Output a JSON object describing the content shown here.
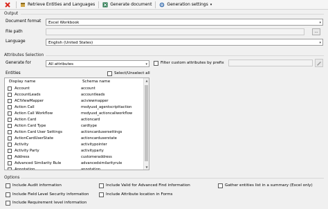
{
  "toolbar": {
    "retrieve_label": "Retrieve Entities and Languages",
    "generate_label": "Generate document",
    "settings_label": "Generation settings"
  },
  "output": {
    "group_label": "Output",
    "format_label": "Document format",
    "format_value": "Excel Workbook",
    "filepath_label": "File path",
    "filepath_value": "",
    "browse_label": "...",
    "language_label": "Language",
    "language_value": "English (United States)"
  },
  "attributes": {
    "group_label": "Attributes Selection",
    "generate_for_label": "Generate for",
    "generate_for_value": "All attributes",
    "filter_label": "Filter custom attributes by prefix",
    "filter_value": ""
  },
  "entities": {
    "label": "Entities",
    "select_all_label": "Select/Unselect all",
    "columns": [
      "Display name",
      "Schema name"
    ],
    "rows": [
      [
        "Account",
        "account"
      ],
      [
        "AccountLeads",
        "accountleads"
      ],
      [
        "ACIViewMapper",
        "aciviewmapper"
      ],
      [
        "Action Call",
        "msdyusd_agentscripttaction"
      ],
      [
        "Action Call Workflow",
        "msdyusd_actioncallworkflow"
      ],
      [
        "Action Card",
        "actioncard"
      ],
      [
        "Action Card Type",
        "cardtype"
      ],
      [
        "Action Card User Settings",
        "actioncardusersettings"
      ],
      [
        "ActionCardUserState",
        "actioncarduserstate"
      ],
      [
        "Activity",
        "activitypointer"
      ],
      [
        "Activity Party",
        "activityparty"
      ],
      [
        "Address",
        "customeraddress"
      ],
      [
        "Advanced Similarity Rule",
        "advancedsimilarityrule"
      ],
      [
        "Annotation",
        "annotation"
      ]
    ]
  },
  "options": {
    "group_label": "Options",
    "items": [
      "Include Audit information",
      "Include Valid for Advanced Find information",
      "Gather entities list in a summary (Excel only)",
      "Include Field Level Security information",
      "Include Attribute location in Forms",
      "Include Requirement level information"
    ]
  },
  "colors": {
    "close_icon": "#d9261c",
    "gear_icon": "#7a7a7a",
    "excel_icon": "#1e7145"
  }
}
